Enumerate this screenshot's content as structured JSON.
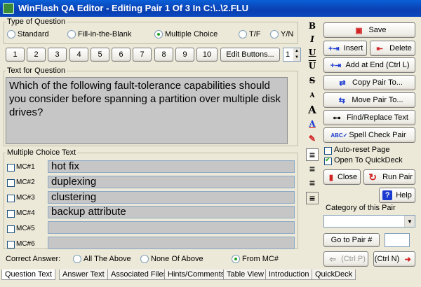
{
  "window": {
    "title": "WinFlash QA Editor - Editing Pair 1 Of 3 In C:\\..\\2.FLU"
  },
  "question_type": {
    "label": "Type of Question",
    "options": [
      "Standard",
      "Fill-in-the-Blank",
      "Multiple Choice",
      "T/F",
      "Y/N"
    ],
    "selected": "Multiple Choice"
  },
  "pair_buttons": [
    "1",
    "2",
    "3",
    "4",
    "5",
    "6",
    "7",
    "8",
    "9",
    "10"
  ],
  "edit_buttons_label": "Edit Buttons...",
  "spin_value": "1",
  "question": {
    "label": "Text for Question",
    "text": "Which of the following fault-tolerance capabilities should you consider before spanning a partition over multiple disk drives?"
  },
  "mc": {
    "label": "Multiple Choice Text",
    "items": [
      {
        "label": "MC#1",
        "text": "hot fix"
      },
      {
        "label": "MC#2",
        "text": "duplexing"
      },
      {
        "label": "MC#3",
        "text": "clustering"
      },
      {
        "label": "MC#4",
        "text": "backup attribute"
      },
      {
        "label": "MC#5",
        "text": ""
      },
      {
        "label": "MC#6",
        "text": ""
      }
    ]
  },
  "correct_answer": {
    "label": "Correct Answer:",
    "options": [
      "All The Above",
      "None Of Above",
      "From MC#"
    ],
    "selected": "From MC#"
  },
  "actions": {
    "save": "Save",
    "insert": "Insert",
    "delete": "Delete",
    "add_at_end": "Add at End (Ctrl L)",
    "copy_pair": "Copy Pair To...",
    "move_pair": "Move Pair To...",
    "find_replace": "Find/Replace Text",
    "spell_check": "Spell Check Pair",
    "auto_reset": "Auto-reset Page",
    "open_quickdeck": "Open To QuickDeck",
    "close": "Close",
    "run_pair": "Run Pair",
    "help": "Help",
    "category_label": "Category of this Pair",
    "goto_pair": "Go to Pair #",
    "prev": "(Ctrl P)",
    "next": "(Ctrl N)"
  },
  "checkboxes": {
    "auto_reset": false,
    "open_quickdeck": true
  },
  "tabs": [
    "Question Text",
    "Answer Text",
    "Associated Files",
    "Hints/Comments",
    "Table View",
    "Introduction",
    "QuickDeck"
  ],
  "active_tab": "Question Text",
  "colors": {
    "titlebar": "#0a48c0",
    "field_bg": "#c6c6c6",
    "accent_green": "#21a121",
    "accent_red": "#d02020"
  }
}
